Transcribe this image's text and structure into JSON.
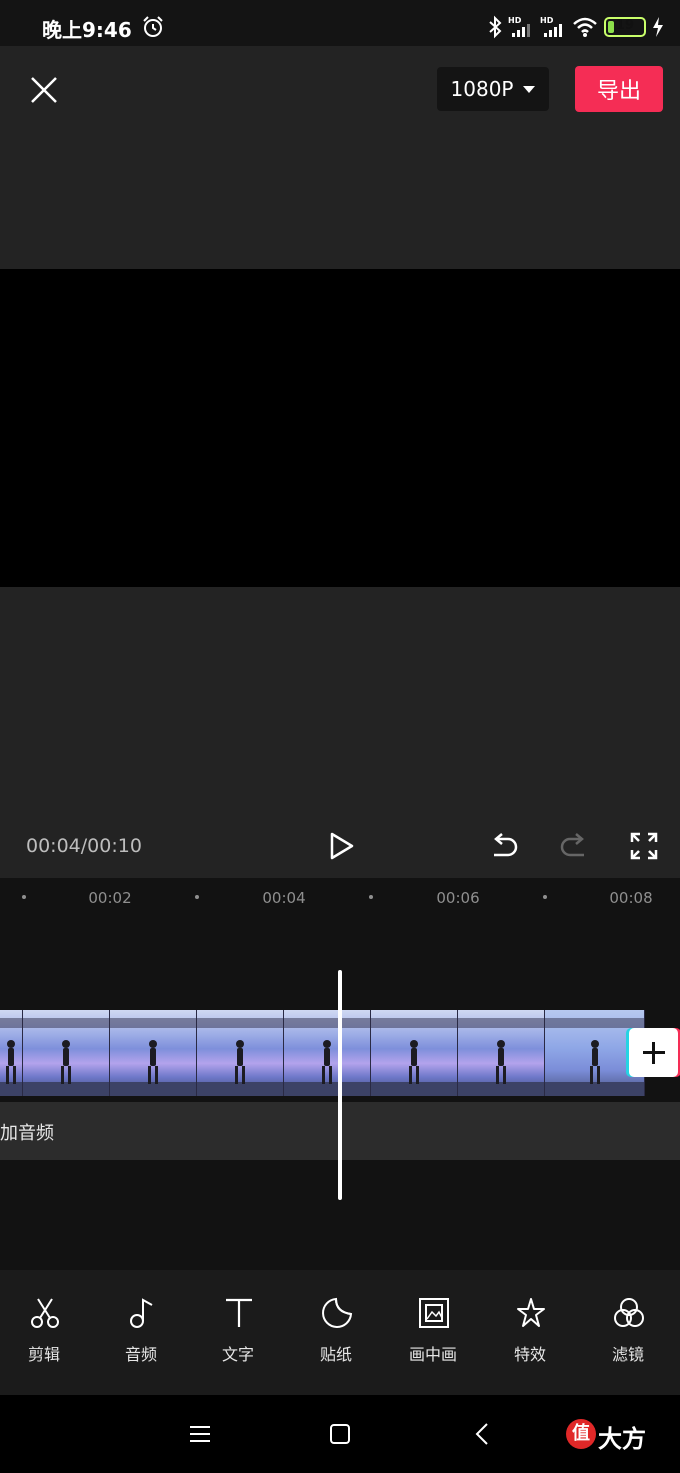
{
  "status_bar": {
    "time": "晚上9:46",
    "battery_level": "19",
    "battery_fraction": 0.19,
    "icons": [
      "alarm-icon",
      "bluetooth-icon",
      "signal-hd-icon",
      "signal-hd-icon",
      "wifi-icon",
      "battery-icon",
      "charging-icon"
    ]
  },
  "top_bar": {
    "resolution": "1080P",
    "export_label": "导出"
  },
  "playback": {
    "time_readout": "00:04/00:10"
  },
  "timeline": {
    "ruler_labels": [
      "00:02",
      "00:04",
      "00:06",
      "00:08"
    ],
    "audio_track_label": "加音频",
    "frame_count": 8
  },
  "toolbar": {
    "items": [
      {
        "label": "剪辑",
        "icon": "scissors-icon"
      },
      {
        "label": "音频",
        "icon": "music-note-icon"
      },
      {
        "label": "文字",
        "icon": "text-icon"
      },
      {
        "label": "贴纸",
        "icon": "sticker-icon"
      },
      {
        "label": "画中画",
        "icon": "picture-in-picture-icon"
      },
      {
        "label": "特效",
        "icon": "effects-star-icon"
      },
      {
        "label": "滤镜",
        "icon": "filter-icon"
      }
    ]
  },
  "nav_bar": {
    "watermark_badge": "值",
    "watermark_text": "大方"
  },
  "colors": {
    "export_accent": "#f52d55",
    "battery_green": "#8de04b",
    "background": "#232323",
    "timeline_bg": "#121212"
  }
}
